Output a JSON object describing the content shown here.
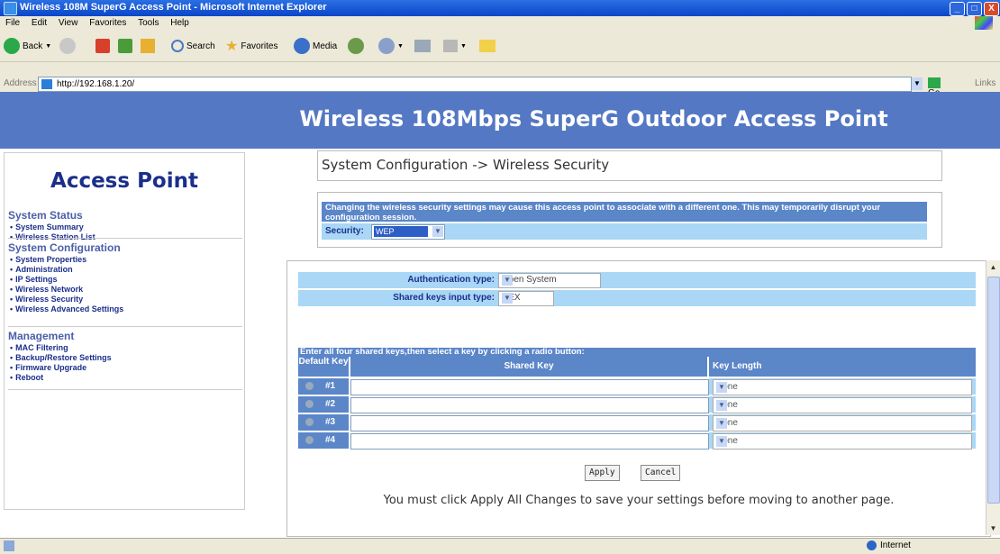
{
  "window": {
    "title": "Wireless 108M SuperG Access Point - Microsoft Internet Explorer",
    "controls": {
      "minimize": "_",
      "maximize": "□",
      "close": "X"
    }
  },
  "menu": [
    "File",
    "Edit",
    "View",
    "Favorites",
    "Tools",
    "Help"
  ],
  "toolbar": {
    "back": "Back",
    "search": "Search",
    "favorites": "Favorites",
    "media": "Media"
  },
  "address": {
    "label": "Address",
    "url": "http://192.168.1.20/",
    "go": "Go",
    "links": "Links"
  },
  "banner": {
    "title": "Wireless 108Mbps SuperG Outdoor Access Point"
  },
  "sidebar": {
    "brand": "Access Point",
    "sections": [
      {
        "heading": "System Status",
        "items": [
          "System Summary",
          "Wireless Station List"
        ]
      },
      {
        "heading": "System Configuration",
        "items": [
          "System Properties",
          "Administration",
          "IP Settings",
          "Wireless Network",
          "Wireless Security",
          "Wireless Advanced Settings"
        ]
      },
      {
        "heading": "Management",
        "items": [
          "MAC Filtering",
          "Backup/Restore Settings",
          "Firmware Upgrade",
          "Reboot"
        ]
      }
    ]
  },
  "main": {
    "breadcrumb": "System Configuration -> Wireless Security",
    "warning": "Changing the wireless security settings may cause this access point to associate with a different one. This may temporarily disrupt your configuration session.",
    "security_label": "Security:",
    "security_value": "WEP",
    "auth_label": "Authentication type:",
    "auth_value": "Open System",
    "input_type_label": "Shared keys input type:",
    "input_type_value": "HEX",
    "keys_instruction": "Enter all four shared keys,then select a key by clicking a radio button:",
    "col_default": "Default Key",
    "col_shared": "Shared Key",
    "col_length": "Key Length",
    "keys": [
      {
        "num": "#1",
        "length": "None"
      },
      {
        "num": "#2",
        "length": "None"
      },
      {
        "num": "#3",
        "length": "None"
      },
      {
        "num": "#4",
        "length": "None"
      }
    ],
    "apply": "Apply",
    "cancel": "Cancel",
    "note": "You must click Apply All Changes to save your settings before moving to another page."
  },
  "status": {
    "zone": "Internet"
  },
  "colors": {
    "banner": "#5478c4",
    "row": "#a9d7f5",
    "header": "#5b86c8",
    "brand": "#1b2f8a"
  }
}
